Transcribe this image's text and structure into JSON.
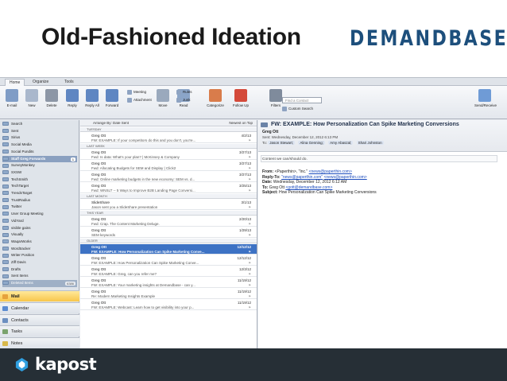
{
  "slide": {
    "title": "Old-Fashioned Ideation",
    "brand": "DEMANDBASE",
    "footer_brand": "kapost"
  },
  "app": {
    "tabs": [
      "Home",
      "Organize",
      "Tools"
    ],
    "ribbon": {
      "buttons": [
        {
          "label": "E-mail",
          "icon": "new-email-icon",
          "color": "#7f9cc6"
        },
        {
          "label": "New",
          "icon": "new-item-icon",
          "color": "#a9b7cc"
        },
        {
          "label": "Delete",
          "icon": "delete-icon",
          "color": "#8c96a6"
        },
        {
          "label": "Reply",
          "icon": "reply-icon",
          "color": "#5f86c2"
        },
        {
          "label": "Reply All",
          "icon": "reply-all-icon",
          "color": "#5f86c2"
        },
        {
          "label": "Forward",
          "icon": "forward-icon",
          "color": "#5f86c2"
        },
        {
          "label": "Move",
          "icon": "move-icon",
          "color": "#9aa9bd"
        },
        {
          "label": "Read",
          "icon": "read-icon",
          "color": "#8ba5c8"
        },
        {
          "label": "Categorize",
          "icon": "categorize-icon",
          "color": "#d97c4b"
        },
        {
          "label": "Follow Up",
          "icon": "follow-up-flag-icon",
          "color": "#d44a3a"
        },
        {
          "label": "Filters",
          "icon": "filter-icon",
          "color": "#7f8b9c"
        },
        {
          "label": "Send/Receive",
          "icon": "send-receive-icon",
          "color": "#6f9bd6"
        }
      ],
      "small": [
        {
          "label": "Meeting",
          "icon": "meeting-icon"
        },
        {
          "label": "Attachment",
          "icon": "attachment-icon"
        },
        {
          "label": "Rules",
          "icon": "rules-icon"
        },
        {
          "label": "Junk",
          "icon": "junk-icon"
        },
        {
          "label": "Custom Search",
          "icon": "custom-search-icon"
        }
      ],
      "find_placeholder": "Find a Contact"
    },
    "nav": {
      "folders": [
        {
          "name": "Search"
        },
        {
          "name": "Sent"
        },
        {
          "name": "Sirius"
        },
        {
          "name": "Social Media"
        },
        {
          "name": "Social Pundits"
        },
        {
          "name": "Staff Greg Forwards",
          "count": "1",
          "selected": true
        },
        {
          "name": "SurveyMonkey"
        },
        {
          "name": "SXSW"
        },
        {
          "name": "TechSmith"
        },
        {
          "name": "TechTarget"
        },
        {
          "name": "TrendsTarget"
        },
        {
          "name": "TrustRadius"
        },
        {
          "name": "Twitter"
        },
        {
          "name": "User Group Meeting"
        },
        {
          "name": "VidYard"
        },
        {
          "name": "visible gains"
        },
        {
          "name": "Visually"
        },
        {
          "name": "WaqarWorks"
        },
        {
          "name": "Wordtracker"
        },
        {
          "name": "Writer Position"
        },
        {
          "name": "Ziff Davis"
        },
        {
          "name": "Drafts"
        },
        {
          "name": "Sent Items"
        },
        {
          "name": "Deleted Items",
          "count": "6386",
          "deleted": true
        }
      ],
      "modules": [
        "Mail",
        "Calendar",
        "Contacts",
        "Tasks",
        "Notes"
      ]
    },
    "list": {
      "arrange": "Arrange By: Date Sent",
      "order": "Newest on Top",
      "rows": [
        {
          "type": "group",
          "label": "Tuesday"
        },
        {
          "type": "msg",
          "from": "Greg Ott",
          "date": "4/2/13",
          "subject": "FW: EXAMPLE: If your competitors do this and you don't, you're..."
        },
        {
          "type": "group",
          "label": "Last Week"
        },
        {
          "type": "msg",
          "from": "Greg Ott",
          "date": "3/27/13",
          "subject": "Fwd: Is data: What's your plan? | McKinsey & Company"
        },
        {
          "type": "msg",
          "from": "Greg Ott",
          "date": "3/27/13",
          "subject": "Fwd: Allocating Budgets for SEM and Display | Click2"
        },
        {
          "type": "msg",
          "from": "Greg Ott",
          "date": "3/27/13",
          "subject": "Fwd: Online marketing budgets in the new economy: SEM vs. d..."
        },
        {
          "type": "msg",
          "from": "Greg Ott",
          "date": "3/25/13",
          "subject": "Fwd: WNSLT -- 5 Ways to Improve B2B Landing Page Conversi..."
        },
        {
          "type": "group",
          "label": "Last Month"
        },
        {
          "type": "msg",
          "from": "SlideShare",
          "date": "3/1/13",
          "subject": "Jason sent you a SlideShare presentation"
        },
        {
          "type": "group",
          "label": "This Year"
        },
        {
          "type": "msg",
          "from": "Greg Ott",
          "date": "2/20/13",
          "subject": "Fwd: Crap. The Content Marketing Deluge."
        },
        {
          "type": "msg",
          "from": "Greg Ott",
          "date": "1/29/13",
          "subject": "SEM keywords"
        },
        {
          "type": "group",
          "label": "Older"
        },
        {
          "type": "msg",
          "from": "Greg Ott",
          "date": "12/12/12",
          "subject": "FW: EXAMPLE: How Personalization Can Spike Marketing Conve...",
          "selected": true
        },
        {
          "type": "msg",
          "from": "Greg Ott",
          "date": "12/12/12",
          "subject": "FW: EXAMPLE: How Personalization Can Spike Marketing Conve..."
        },
        {
          "type": "msg",
          "from": "Greg Ott",
          "date": "12/3/12",
          "subject": "FW: EXAMPLE: Greg, can you refer me?"
        },
        {
          "type": "msg",
          "from": "Greg Ott",
          "date": "11/19/12",
          "subject": "FW: EXAMPLE: Your marketing insights at Demandbase - can y..."
        },
        {
          "type": "msg",
          "from": "Greg Ott",
          "date": "11/19/12",
          "subject": "Re: Modern Marketing Insights Example"
        },
        {
          "type": "msg",
          "from": "Greg Ott",
          "date": "11/19/12",
          "subject": "FW: EXAMPLE: Webcast: Learn how to get visibility into your p..."
        }
      ]
    },
    "reading": {
      "subject": "FW: EXAMPLE: How Personalization Can Spike Marketing Conversions",
      "from": "Greg Ott",
      "sent_label": "Sent:",
      "sent": "Wednesday, December 12, 2012 6:13 PM",
      "to_label": "To:",
      "to": [
        "Jason Stewart;",
        "Alina Genning;",
        "Amy Abaszal;",
        "Shari Johnston"
      ],
      "notice": "Content we can/should do.",
      "forward": {
        "from_label": "From:",
        "from_name": "<Paperthin>, \"Inc.\"",
        "from_email": "<news@paperthin.com>",
        "reply_label": "Reply-To:",
        "reply_name": "\"news@paperthin.com\"",
        "reply_email": "<news@paperthin.com>",
        "date_label": "Date:",
        "date": "Wednesday, December 12, 2012 6:12 AM",
        "to_label": "To:",
        "to_name": "Greg Ott",
        "to_email": "<gott@demandbase.com>",
        "subject_label": "Subject:",
        "subject": "How Personalization Can Spike Marketing Conversions"
      }
    }
  },
  "colors": {
    "selected_row": "#3d72c4",
    "mail_module": "#f8c64a",
    "footer_bg": "#262f36",
    "brand_blue": "#1d4f7c"
  }
}
